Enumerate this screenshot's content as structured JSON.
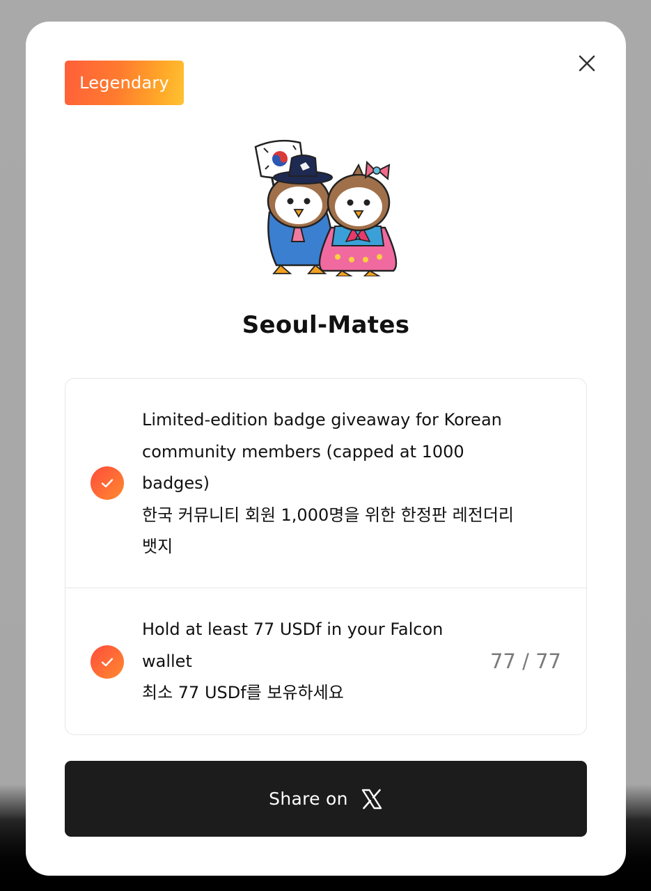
{
  "badge": {
    "rarity_label": "Legendary",
    "title": "Seoul-Mates",
    "image_icon": "seoul-mates-mascot-illustration"
  },
  "requirements": [
    {
      "lines": [
        "Limited-edition badge giveaway for Korean",
        "community members (capped at 1000",
        "badges)",
        "한국 커뮤니티 회원 1,000명을 위한 한정판 레전더리",
        "뱃지"
      ],
      "completed": true,
      "icon": "check-circle-icon"
    },
    {
      "lines": [
        "Hold at least 77 USDf in your Falcon",
        "wallet",
        "최소 77 USDf를 보유하세요"
      ],
      "completed": true,
      "icon": "check-circle-icon",
      "progress": "77 / 77"
    }
  ],
  "actions": {
    "share_label": "Share on",
    "share_icon": "x-logo-icon",
    "close_icon": "close-icon"
  },
  "colors": {
    "accent_gradient_start": "#ff5f3a",
    "accent_gradient_end": "#ffc233",
    "button_bg": "#1c1c1c",
    "progress_text": "#7a7a7a"
  }
}
